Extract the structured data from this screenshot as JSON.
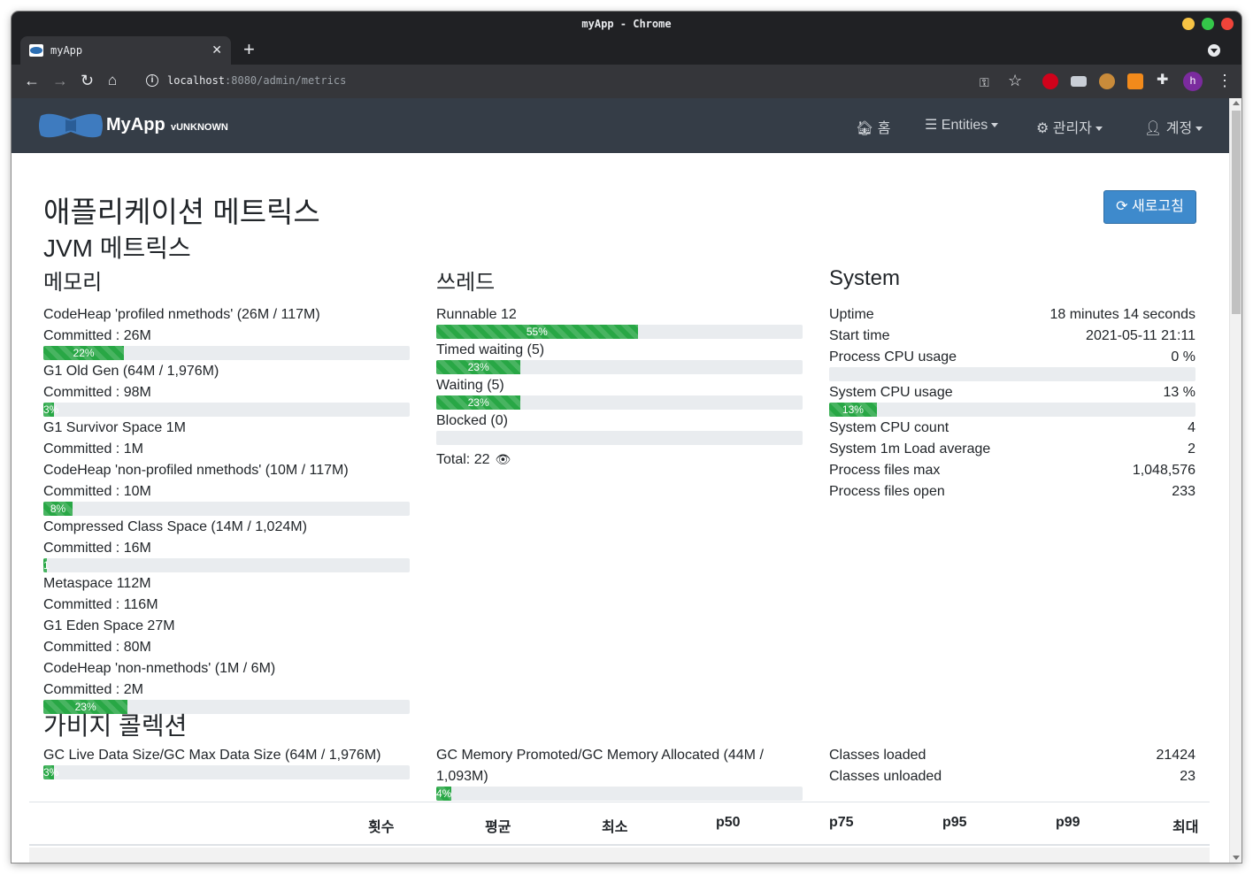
{
  "window": {
    "title": "myApp - Chrome"
  },
  "tab": {
    "title": "myApp"
  },
  "address": {
    "host": "localhost",
    "rest": ":8080/admin/metrics"
  },
  "navbar": {
    "brand": "MyApp",
    "version": "vUNKNOWN",
    "items": [
      {
        "label": "홈",
        "icon": "home-icon"
      },
      {
        "label": "Entities",
        "icon": "list-icon"
      },
      {
        "label": "관리자",
        "icon": "users-cog-icon"
      },
      {
        "label": "계정",
        "icon": "user-icon"
      }
    ]
  },
  "page": {
    "title": "애플리케이션 메트릭스",
    "refresh_label": "새로고침",
    "jvm_title": "JVM 메트릭스",
    "gc_title": "가비지 콜렉션"
  },
  "memory": {
    "title": "메모리",
    "items": [
      {
        "name": "CodeHeap 'profiled nmethods' (26M / 117M)",
        "committed": "Committed : 26M",
        "percent": 22,
        "label": "22%"
      },
      {
        "name": "G1 Old Gen (64M / 1,976M)",
        "committed": "Committed : 98M",
        "percent": 3,
        "label": "3%"
      },
      {
        "name": "G1 Survivor Space 1M",
        "committed": "Committed : 1M"
      },
      {
        "name": "CodeHeap 'non-profiled nmethods' (10M / 117M)",
        "committed": "Committed : 10M",
        "percent": 8,
        "label": "8%"
      },
      {
        "name": "Compressed Class Space (14M / 1,024M)",
        "committed": "Committed : 16M",
        "percent": 1,
        "label": "1"
      },
      {
        "name": "Metaspace 112M",
        "committed": "Committed : 116M"
      },
      {
        "name": "G1 Eden Space 27M",
        "committed": "Committed : 80M"
      },
      {
        "name": "CodeHeap 'non-nmethods' (1M / 6M)",
        "committed": "Committed : 2M",
        "percent": 23,
        "label": "23%"
      }
    ]
  },
  "threads": {
    "title": "쓰레드",
    "items": [
      {
        "name": "Runnable 12",
        "percent": 55,
        "label": "55%"
      },
      {
        "name": "Timed waiting (5)",
        "percent": 23,
        "label": "23%"
      },
      {
        "name": "Waiting (5)",
        "percent": 23,
        "label": "23%"
      },
      {
        "name": "Blocked (0)",
        "percent": 0,
        "label": ""
      }
    ],
    "total": "Total: 22"
  },
  "system": {
    "title": "System",
    "rows": [
      {
        "k": "Uptime",
        "v": "18 minutes 14 seconds"
      },
      {
        "k": "Start time",
        "v": "2021-05-11 21:11"
      },
      {
        "k": "Process CPU usage",
        "v": "0 %",
        "percent": 0,
        "label": ""
      },
      {
        "k": "System CPU usage",
        "v": "13 %",
        "percent": 13,
        "label": "13%"
      },
      {
        "k": "System CPU count",
        "v": "4"
      },
      {
        "k": "System 1m Load average",
        "v": "2"
      },
      {
        "k": "Process files max",
        "v": "1,048,576"
      },
      {
        "k": "Process files open",
        "v": "233"
      }
    ]
  },
  "gc": {
    "live": {
      "name": "GC Live Data Size/GC Max Data Size (64M / 1,976M)",
      "percent": 3,
      "label": "3%"
    },
    "promoted": {
      "name_line1": "GC Memory Promoted/GC Memory Allocated (44M /",
      "name_line2": "1,093M)",
      "percent": 4,
      "label": "4%"
    },
    "classes": [
      {
        "k": "Classes loaded",
        "v": "21424"
      },
      {
        "k": "Classes unloaded",
        "v": "23"
      }
    ]
  },
  "table": {
    "headers": [
      "횟수",
      "평균",
      "최소",
      "p50",
      "p75",
      "p95",
      "p99",
      "최대"
    ]
  }
}
